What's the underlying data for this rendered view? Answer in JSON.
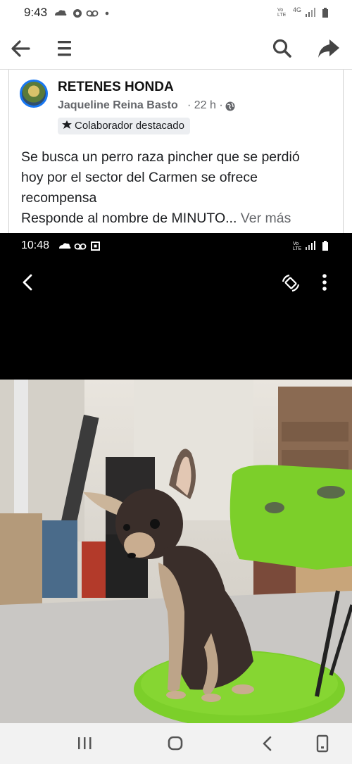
{
  "status_bar": {
    "time": "9:43",
    "network": "4G",
    "volte": "Vo LTE"
  },
  "toolbar": {
    "back_icon": "arrow-left-icon",
    "menu_icon": "hamburger-icon",
    "search_icon": "search-icon",
    "share_icon": "share-arrow-icon"
  },
  "post": {
    "group_name": "RETENES HONDA",
    "author": "Jaqueline Reina Basto",
    "meta": "· 22 h ·",
    "badge": "Colaborador destacado",
    "text_lines": [
      "Se busca un perro raza pincher que se perdió",
      "hoy por el sector del Carmen se ofrece",
      "recompensa",
      "Responde al nombre de MINUTO..."
    ],
    "see_more": "Ver más"
  },
  "photo": {
    "inner_time": "10:48",
    "inner_volte": "Vo LTE",
    "colors": {
      "chair": "#7ccf2a",
      "dog": "#3a2e2a",
      "bg": "#000000"
    }
  },
  "navbar": {
    "recent_icon": "recent-apps-icon",
    "home_icon": "home-icon",
    "back_icon": "back-chevron-icon",
    "assist_icon": "screenshot-icon"
  },
  "colors": {
    "accent": "#1877f2",
    "muted": "#65676b"
  }
}
